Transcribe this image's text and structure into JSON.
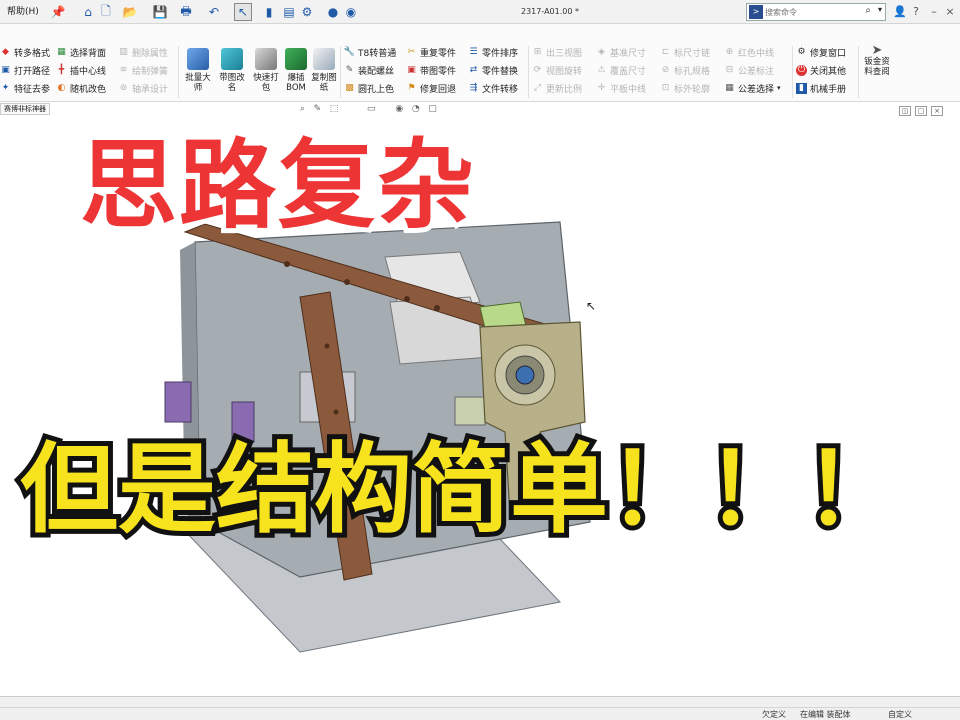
{
  "titlebar": {
    "help_menu": "帮助(H)",
    "doc_title": "2317-A01.00 *",
    "search_placeholder": "搜索命令",
    "help_symbol": "?",
    "min_symbol": "–",
    "close_symbol": "×"
  },
  "ribbon": {
    "col1": [
      "转多格式",
      "打开路径",
      "特征去参"
    ],
    "col2": [
      "选择背面",
      "插中心线",
      "随机改色"
    ],
    "col3": [
      "删除属性",
      "绘制弹簧",
      "轴承设计"
    ],
    "big_buttons": [
      "批量大\n师",
      "带图改\n名",
      "快速打\n包",
      "爆插\nBOM",
      "复制图\n纸"
    ],
    "col4": [
      "T8转普通",
      "装配螺丝",
      "圆孔上色"
    ],
    "col5": [
      "重复零件",
      "带图零件",
      "修复回退"
    ],
    "col6": [
      "零件排序",
      "零件替换",
      "文件转移"
    ],
    "col7": [
      "出三视图",
      "视图旋转",
      "更新比例"
    ],
    "col8": [
      "基准尺寸",
      "覆盖尺寸",
      "平板中线"
    ],
    "col9": [
      "标尺寸链",
      "标孔规格",
      "标外轮廓"
    ],
    "col10": [
      "红色中线",
      "公差标注",
      "公差选择"
    ],
    "col11": [
      "修复窗口",
      "关闭其他",
      "机械手册"
    ],
    "last_big": "钣金资\n料查阅"
  },
  "tab_tooltip": "赛博非标神器",
  "overlay": {
    "line1": "思路复杂",
    "line2": "但是结构简单！！！"
  },
  "status": {
    "s1": "欠定义",
    "s2": "在编辑 装配体",
    "s3": "自定义"
  },
  "colors": {
    "accent": "#1e5aa8",
    "overlay_red": "#ee3535",
    "overlay_yellow": "#f7e21e",
    "bar_wood": "#8b5a3c",
    "plate_gray": "#a5acb2",
    "bracket_olive": "#b8b088"
  }
}
